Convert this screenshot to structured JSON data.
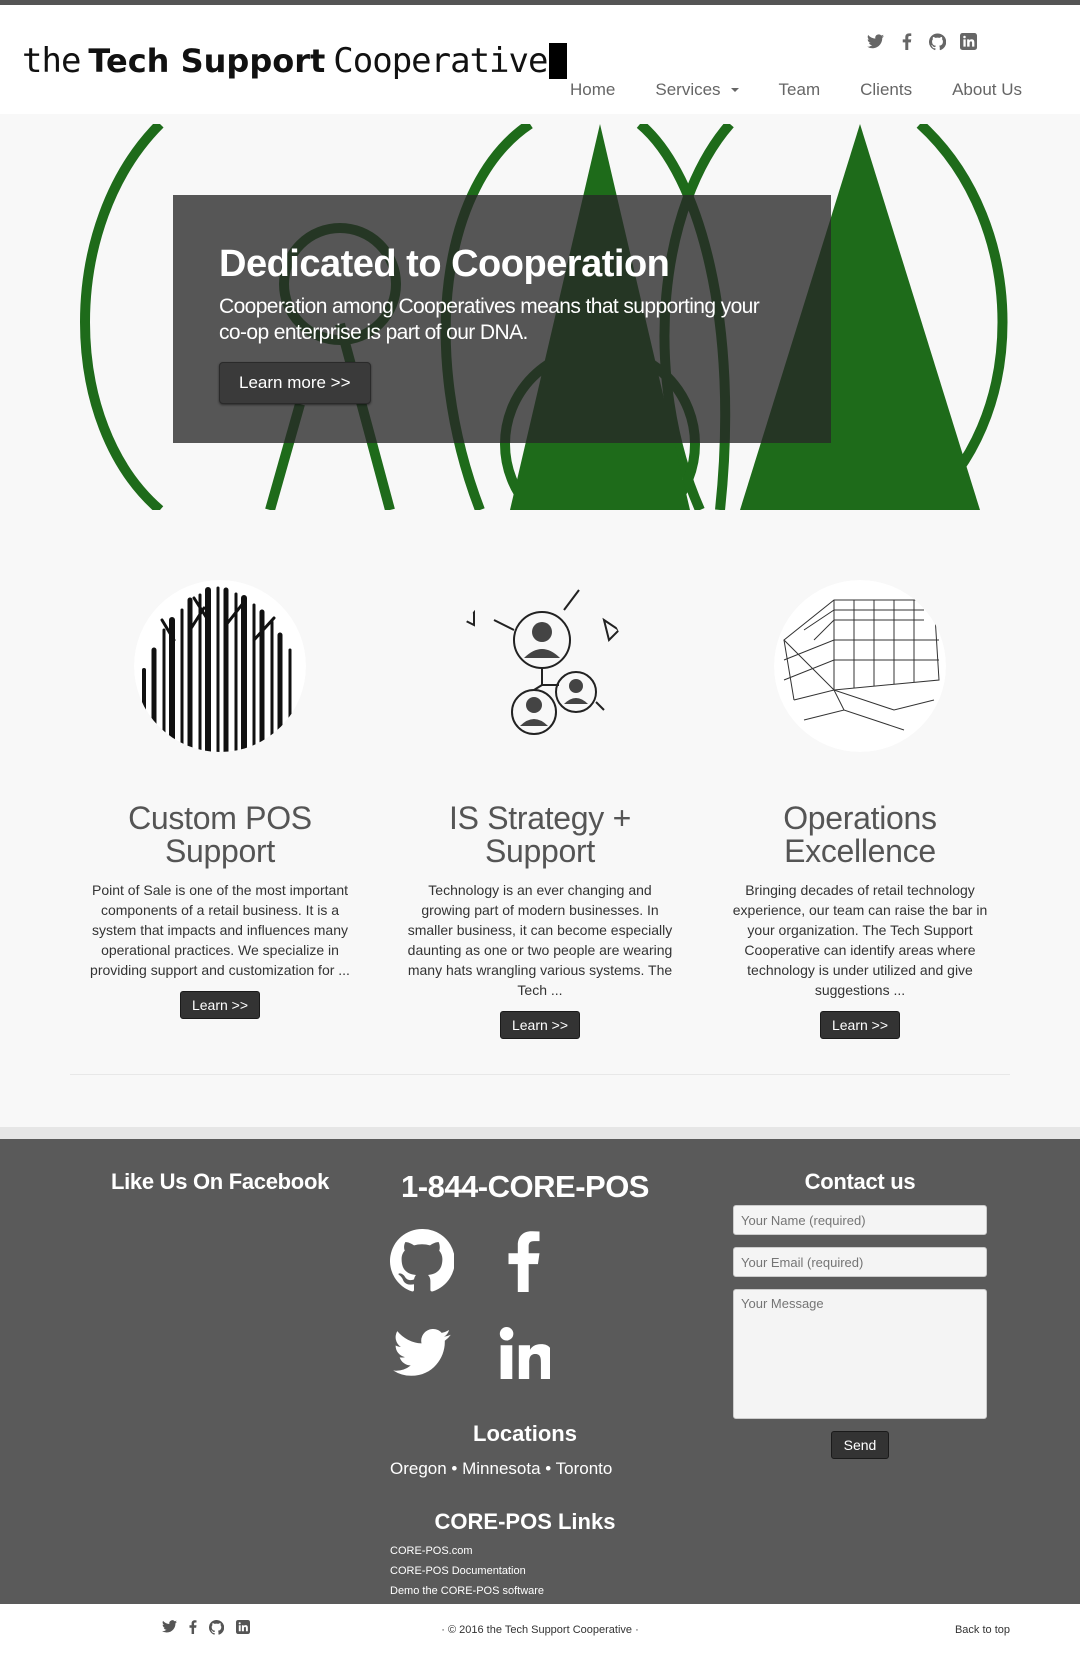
{
  "header": {
    "logo": {
      "part1": "the",
      "part2": "Tech Support",
      "part3": "Cooperative"
    },
    "social": [
      "twitter-icon",
      "facebook-icon",
      "github-icon",
      "linkedin-icon"
    ],
    "nav": [
      {
        "label": "Home"
      },
      {
        "label": "Services",
        "dropdown": true
      },
      {
        "label": "Team"
      },
      {
        "label": "Clients"
      },
      {
        "label": "About Us"
      }
    ]
  },
  "hero": {
    "title": "Dedicated to Cooperation",
    "text": "Cooperation among Cooperatives means that supporting your co-op enterprise is part of our DNA.",
    "button": "Learn more >>",
    "accent": "#1e6b1a"
  },
  "features": [
    {
      "title": "Custom POS Support",
      "text": "Point of Sale is one of the most important components of a retail business. It is a system that impacts and influences many operational practices. We specialize in providing support and customization for ...",
      "button": "Learn >>"
    },
    {
      "title": "IS Strategy + Support",
      "text": "Technology is an ever changing and growing part of modern businesses. In smaller business, it can become especially daunting as one or two people are wearing many hats wrangling various systems. The Tech ...",
      "button": "Learn >>"
    },
    {
      "title": "Operations Excellence",
      "text": "Bringing decades of retail technology experience, our team can raise the bar in your organization. The Tech Support Cooperative can identify areas where technology is under utilized and give suggestions ...",
      "button": "Learn >>"
    }
  ],
  "footer": {
    "facebook_title": "Like Us On Facebook",
    "phone": "1-844-CORE-POS",
    "big_social": [
      "github-icon",
      "facebook-icon",
      "twitter-icon",
      "linkedin-icon"
    ],
    "locations_title": "Locations",
    "locations": "Oregon • Minnesota • Toronto",
    "links_title": "CORE-POS Links",
    "links": [
      "CORE-POS.com",
      "CORE-POS Documentation",
      "Demo the CORE-POS software"
    ],
    "contact_title": "Contact us",
    "name_placeholder": "Your Name (required)",
    "email_placeholder": "Your Email (required)",
    "message_placeholder": "Your Message",
    "send": "Send"
  },
  "bottom": {
    "copyright": "· © 2016 the Tech Support Cooperative ·",
    "back_to_top": "Back to top"
  }
}
